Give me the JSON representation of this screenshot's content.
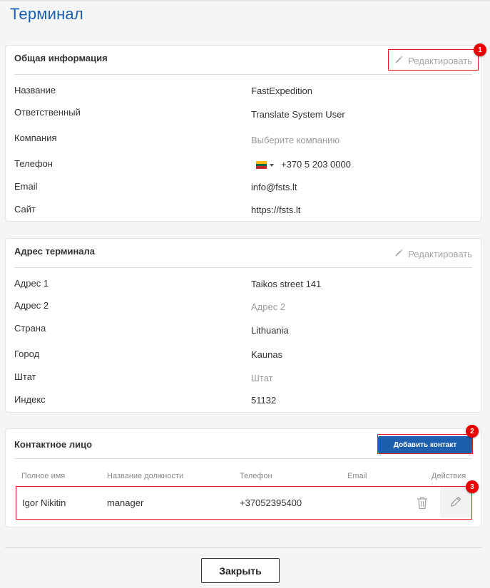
{
  "page": {
    "title": "Терминал"
  },
  "general": {
    "title": "Общая информация",
    "edit_label": "Редактировать",
    "badge": "1",
    "rows": [
      {
        "label": "Название",
        "value": "FastExpedition"
      },
      {
        "label": "Ответственный",
        "value": "Translate System User"
      },
      {
        "label": "Компания",
        "placeholder": "Выберите компанию"
      },
      {
        "label": "Телефон",
        "value": "+370 5 203 0000"
      },
      {
        "label": "Email",
        "value": "info@fsts.lt"
      },
      {
        "label": "Сайт",
        "value": "https://fsts.lt"
      }
    ],
    "phone_flag_colors": [
      "#fdb913",
      "#006a44",
      "#c1272d"
    ]
  },
  "address": {
    "title": "Адрес терминала",
    "edit_label": "Редактировать",
    "rows": [
      {
        "label": "Адрес 1",
        "value": "Taikos street 141"
      },
      {
        "label": "Адрес 2",
        "placeholder": "Адрес 2"
      },
      {
        "label": "Страна",
        "value": "Lithuania"
      },
      {
        "label": "Город",
        "value": "Kaunas"
      },
      {
        "label": "Штат",
        "placeholder": "Штат"
      },
      {
        "label": "Индекс",
        "value": "51132"
      }
    ]
  },
  "contacts": {
    "title": "Контактное лицо",
    "add_button": "Добавить контакт",
    "add_badge": "2",
    "row_badge": "3",
    "columns": [
      "Полное имя",
      "Название должности",
      "Телефон",
      "Email",
      "Действия"
    ],
    "rows": [
      {
        "name": "Igor Nikitin",
        "position": "manager",
        "phone": "+37052395400",
        "email": "",
        "icons": [
          "trash-icon",
          "pencil-icon"
        ]
      }
    ]
  },
  "footer": {
    "close_label": "Закрыть"
  },
  "colors": {
    "accent": "#1d5fae",
    "highlight": "#e11d1d",
    "badge": "#e60000"
  }
}
